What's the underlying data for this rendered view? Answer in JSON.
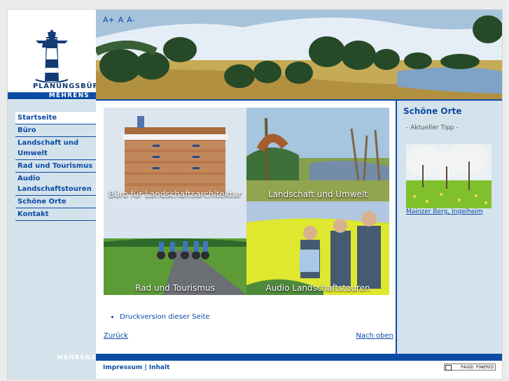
{
  "brand": {
    "word_top": "PLANUNGSBÜRO",
    "word_bottom": "MEHRENS",
    "sidebar_footer": "MEHRENS"
  },
  "font_tools": [
    "A+",
    "A",
    "A-"
  ],
  "nav": [
    {
      "label": "Startseite",
      "active": true
    },
    {
      "label": "Büro",
      "active": false
    },
    {
      "label": "Landschaft und Umwelt",
      "active": false
    },
    {
      "label": "Rad und Tourismus",
      "active": false
    },
    {
      "label": "Audio Landschaftstouren",
      "active": false
    },
    {
      "label": "Schöne Orte",
      "active": false
    },
    {
      "label": "Kontakt",
      "active": false
    }
  ],
  "tiles": [
    {
      "caption": "Büro für Landschaftsarchitektur"
    },
    {
      "caption": "Landschaft und Umwelt"
    },
    {
      "caption": "Rad und Tourismus"
    },
    {
      "caption": "Audio Landschaftstouren"
    }
  ],
  "links": {
    "print": "Druckversion dieser Seite",
    "back": "Zurück",
    "top": "Nach oben"
  },
  "right": {
    "title": "Schöne Orte",
    "subtitle": "- Aktueller Tipp -",
    "caption": "Mainzer Berg, Ingelheim"
  },
  "footer": {
    "links": "Impressum | Inhalt",
    "badge": "PAGOD POWERED"
  },
  "colors": {
    "accent": "#0c4ca3",
    "sidebar": "#d4e2ec"
  }
}
